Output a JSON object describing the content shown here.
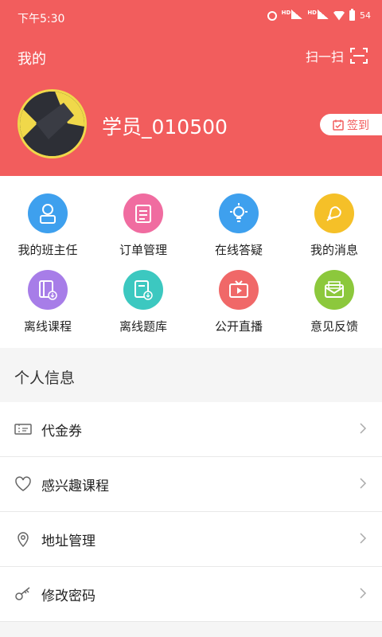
{
  "status_bar": {
    "time": "下午5:30",
    "battery": "54",
    "icons": [
      "alarm-icon",
      "hd-signal-icon",
      "hd-signal-icon",
      "wifi-icon",
      "battery-icon"
    ]
  },
  "header": {
    "title": "我的",
    "scan_label": "扫一扫",
    "username": "学员_010500",
    "signin_label": "签到",
    "background_color": "#f25d5d"
  },
  "grid": {
    "items": [
      {
        "label": "我的班主任",
        "icon": "teacher-icon",
        "color": "#3ea0ee"
      },
      {
        "label": "订单管理",
        "icon": "order-icon",
        "color": "#f06ca0"
      },
      {
        "label": "在线答疑",
        "icon": "lightbulb-icon",
        "color": "#3ea0ee"
      },
      {
        "label": "我的消息",
        "icon": "bell-icon",
        "color": "#f5c028"
      },
      {
        "label": "离线课程",
        "icon": "offline-course-icon",
        "color": "#a77de8"
      },
      {
        "label": "离线题库",
        "icon": "offline-questions-icon",
        "color": "#3cc8c0"
      },
      {
        "label": "公开直播",
        "icon": "live-tv-icon",
        "color": "#f06868"
      },
      {
        "label": "意见反馈",
        "icon": "feedback-mail-icon",
        "color": "#8cc83c"
      }
    ]
  },
  "personal_info": {
    "title": "个人信息",
    "rows": [
      {
        "label": "代金券",
        "icon": "coupon-icon"
      },
      {
        "label": "感兴趣课程",
        "icon": "heart-icon"
      },
      {
        "label": "地址管理",
        "icon": "location-icon"
      },
      {
        "label": "修改密码",
        "icon": "key-icon"
      }
    ]
  }
}
